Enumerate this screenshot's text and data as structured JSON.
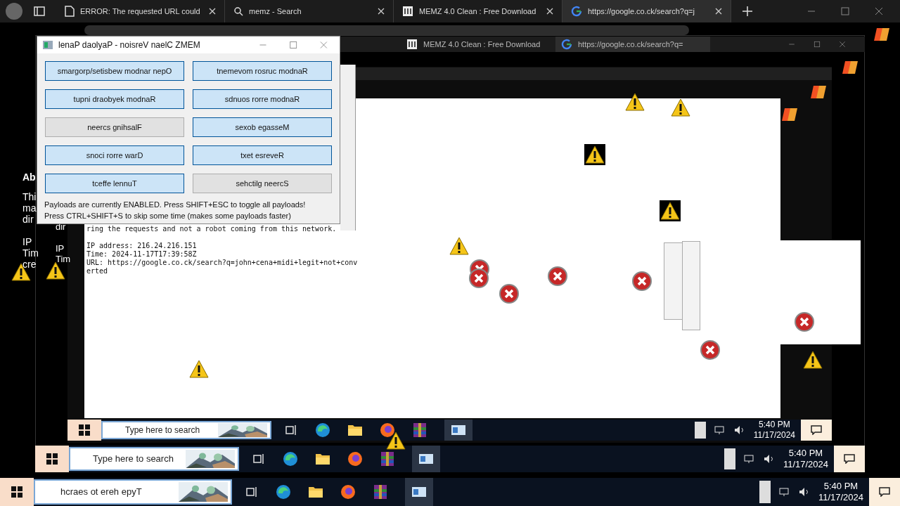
{
  "browser": {
    "tabs": [
      {
        "title": "ERROR: The requested URL could",
        "selected": false
      },
      {
        "title": "memz - Search",
        "selected": false
      },
      {
        "title": "MEMZ 4.0 Clean : Free Download",
        "selected": false
      },
      {
        "title": "https://google.co.ck/search?q=j",
        "selected": true
      }
    ]
  },
  "nested_browser": {
    "tabs": [
      {
        "title": "MEMZ 4.0 Clean : Free Download",
        "selected": false
      },
      {
        "title": "https://google.co.ck/search?q=",
        "selected": true
      }
    ]
  },
  "left_fragments": [
    "Ab",
    "Thi",
    "ma",
    "dir",
    "IP",
    "Tim",
    "cre"
  ],
  "nested_fragments": [
    "dir",
    "IP",
    "Tim"
  ],
  "error_page": {
    "lines": [
      "ring the requests and not a robot coming from this network.",
      "IP address: 216.24.216.151",
      "Time: 2024-11-17T17:39:58Z",
      "URL: https://google.co.ck/search?q=john+cena+midi+legit+not+conv",
      "erted"
    ]
  },
  "memz_panel": {
    "title": "lenaP daolyaP - noisreV naelC ZMEM",
    "buttons": [
      {
        "label": "smargorp/setisbew modnar nepO",
        "on": true
      },
      {
        "label": "tnemevom rosruc modnaR",
        "on": true
      },
      {
        "label": "tupni draobyek modnaR",
        "on": true
      },
      {
        "label": "sdnuos rorre modnaR",
        "on": true
      },
      {
        "label": "neercs gnihsalF",
        "on": false
      },
      {
        "label": "sexob egasseM",
        "on": true
      },
      {
        "label": "snoci rorre warD",
        "on": true
      },
      {
        "label": "txet esreveR",
        "on": true
      },
      {
        "label": "tceffe lennuT",
        "on": true
      },
      {
        "label": "sehctilg neercS",
        "on": false
      }
    ],
    "status_lines": [
      "Payloads are currently ENABLED. Press SHIFT+ESC to toggle all payloads!",
      "Press CTRL+SHIFT+S to skip some time (makes some payloads faster)"
    ]
  },
  "alerts": [
    {
      "kind": "warning"
    },
    {
      "kind": "warning"
    },
    {
      "kind": "warning"
    },
    {
      "kind": "warning"
    },
    {
      "kind": "warning"
    },
    {
      "kind": "warning"
    },
    {
      "kind": "warning"
    },
    {
      "kind": "warning"
    },
    {
      "kind": "warning"
    },
    {
      "kind": "warning"
    },
    {
      "kind": "error"
    },
    {
      "kind": "error"
    },
    {
      "kind": "error"
    },
    {
      "kind": "error"
    },
    {
      "kind": "error"
    },
    {
      "kind": "error"
    },
    {
      "kind": "error"
    }
  ],
  "taskbars": [
    {
      "search": "Type here to search",
      "time": "5:40 PM",
      "date": "11/17/2024"
    },
    {
      "search": "Type here to search",
      "time": "5:40 PM",
      "date": "11/17/2024"
    },
    {
      "search": "hcraes ot ereh epyT",
      "time": "5:40 PM",
      "date": "11/17/2024"
    }
  ]
}
